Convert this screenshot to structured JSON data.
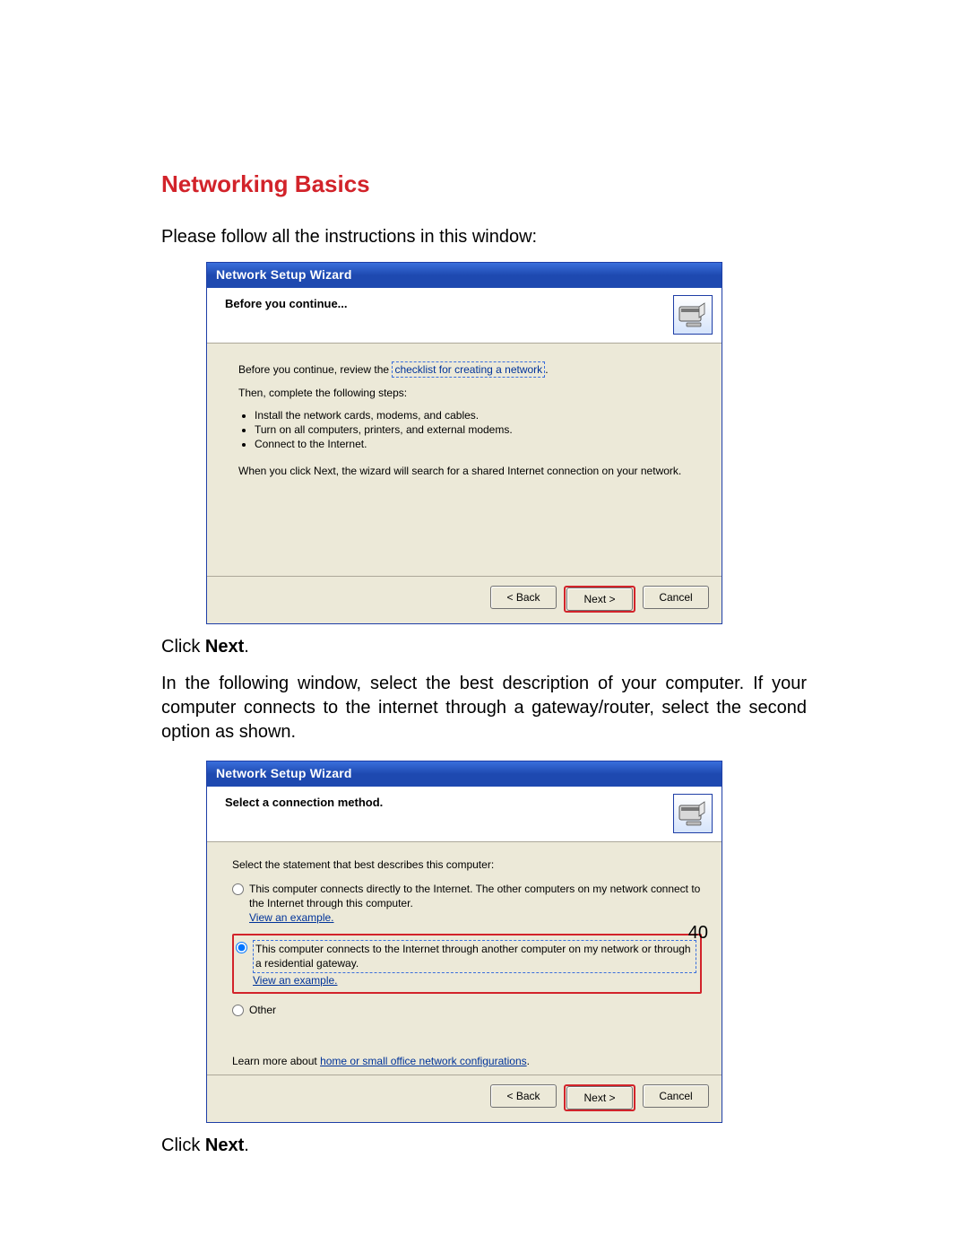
{
  "heading": "Networking Basics",
  "intro": "Please follow all the instructions in this window:",
  "click_next_prefix": "Click ",
  "click_next_bold": "Next",
  "click_next_suffix": ".",
  "para2": "In the following window, select the best description of your computer. If your computer connects to the internet through a gateway/router, select the second option as shown.",
  "page_number": "40",
  "wizard1": {
    "title": "Network Setup Wizard",
    "header": "Before you continue...",
    "line1_prefix": "Before you continue, review the ",
    "line1_link": "checklist for creating a network",
    "line1_suffix": ".",
    "then": "Then, complete the following steps:",
    "bullets": [
      "Install the network cards, modems, and cables.",
      "Turn on all computers, printers, and external modems.",
      "Connect to the Internet."
    ],
    "when_next": "When you click Next, the wizard will search for a shared Internet connection on your network.",
    "back": "< Back",
    "next": "Next >",
    "cancel": "Cancel"
  },
  "wizard2": {
    "title": "Network Setup Wizard",
    "header": "Select a connection method.",
    "select_stmt": "Select the statement that best describes this computer:",
    "opt1": "This computer connects directly to the Internet. The other computers on my network connect to the Internet through this computer.",
    "view_example": "View an example.",
    "opt2": "This computer connects to the Internet through another computer on my network or through a residential gateway.",
    "opt3": "Other",
    "learn_prefix": "Learn more about ",
    "learn_link": "home or small office network configurations",
    "learn_suffix": ".",
    "back": "< Back",
    "next": "Next >",
    "cancel": "Cancel"
  }
}
